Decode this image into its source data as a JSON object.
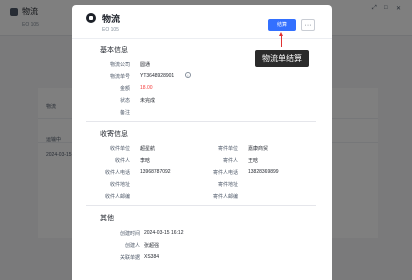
{
  "background": {
    "title": "物流",
    "subtitle": "EO 105",
    "section_label": "物流",
    "cell_a": "运输中",
    "cell_b": "2024-03-15"
  },
  "modal": {
    "title": "物流",
    "id": "EO 105",
    "settle_button": "结算",
    "more_button": "···"
  },
  "basic": {
    "heading": "基本信息",
    "rows": [
      {
        "label": "物流公司",
        "value": "圆通"
      },
      {
        "label": "物流单号",
        "value": "YT3648928901"
      },
      {
        "label": "金额",
        "value": "18.00"
      },
      {
        "label": "状态",
        "value": "未完成"
      },
      {
        "label": "备注",
        "value": ""
      }
    ]
  },
  "recipient": {
    "heading": "收寄信息",
    "left": [
      {
        "label": "收件单位",
        "value": "超星航"
      },
      {
        "label": "收件人",
        "value": "李晗"
      },
      {
        "label": "收件人电话",
        "value": "13968787092"
      },
      {
        "label": "收件地址",
        "value": ""
      },
      {
        "label": "收件人邮编",
        "value": ""
      }
    ],
    "right": [
      {
        "label": "寄件单位",
        "value": "嘉康商贸"
      },
      {
        "label": "寄件人",
        "value": "王晗"
      },
      {
        "label": "寄件人电话",
        "value": "13828369899"
      },
      {
        "label": "寄件地址",
        "value": ""
      },
      {
        "label": "寄件人邮编",
        "value": ""
      }
    ]
  },
  "other": {
    "heading": "其他",
    "rows": [
      {
        "label": "创建时间",
        "value": "2024-03-15 16:12"
      },
      {
        "label": "创建人",
        "value": "张超强"
      },
      {
        "label": "关联单据",
        "value": "XS384"
      }
    ]
  },
  "annotation": {
    "text": "物流单结算",
    "color": "#e03131"
  },
  "colors": {
    "primary": "#3370ff",
    "amount": "#f53f3f"
  }
}
